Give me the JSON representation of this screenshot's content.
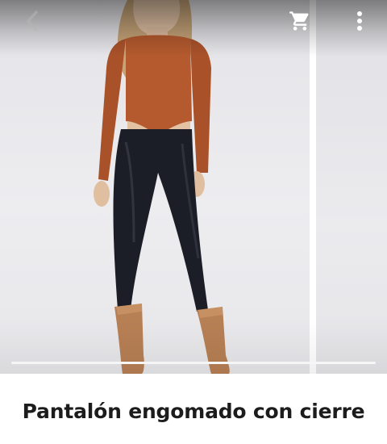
{
  "toolbar": {
    "back_icon": "chevron-left-icon",
    "cart_icon": "shopping-cart-icon",
    "menu_icon": "more-vertical-icon"
  },
  "gallery": {
    "photo": "model-wearing-leather-pants-photo"
  },
  "product": {
    "title": "Pantalón engomado con cierre"
  }
}
